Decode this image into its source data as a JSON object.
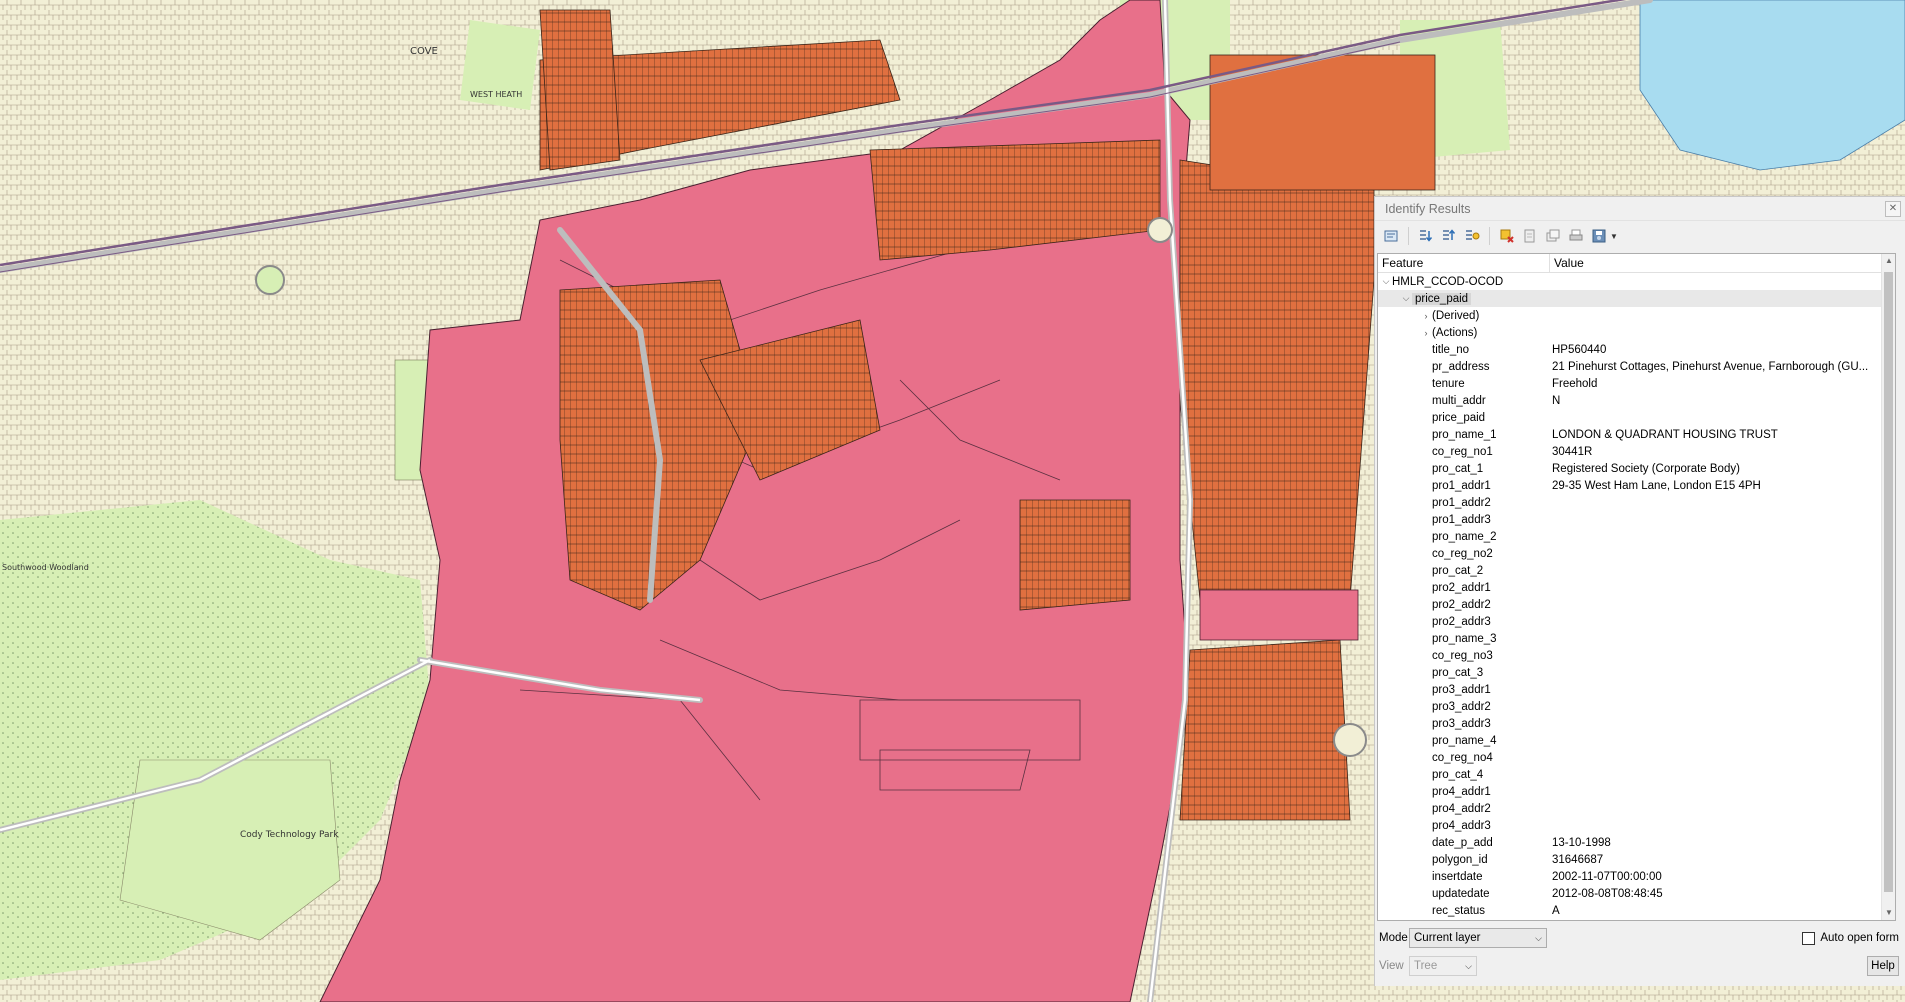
{
  "map": {
    "labels": {
      "cove": "COVE",
      "west_heath": "WEST HEATH",
      "southwood": "Southwood Woodland",
      "cody": "Cody Technology Park"
    },
    "colors": {
      "background": "#f2efd6",
      "green_space": "#d7efb5",
      "water": "#a8dcf0",
      "pink_parcel": "#e8708a",
      "orange_parcel": "#e07040",
      "road": "#bfbfbf",
      "railway": "#7a5a85"
    }
  },
  "identify": {
    "title": "Identify Results",
    "close_label": "✕",
    "toolbar_icons": [
      "expand-tree-icon",
      "expand-all-icon",
      "collapse-all-icon",
      "expand-new-icon",
      "clear-highlight-icon",
      "clear-results-icon",
      "copy-icon",
      "print-icon",
      "save-icon"
    ],
    "header": {
      "feature": "Feature",
      "value": "Value"
    },
    "layer": "HMLR_CCOD-OCOD",
    "feature_node": "price_paid",
    "sub_nodes": [
      "(Derived)",
      "(Actions)"
    ],
    "attributes": [
      {
        "name": "title_no",
        "value": "HP560440"
      },
      {
        "name": "pr_address",
        "value": "21 Pinehurst Cottages, Pinehurst Avenue, Farnborough (GU..."
      },
      {
        "name": "tenure",
        "value": "Freehold"
      },
      {
        "name": "multi_addr",
        "value": "N"
      },
      {
        "name": "price_paid",
        "value": ""
      },
      {
        "name": "pro_name_1",
        "value": "LONDON & QUADRANT HOUSING TRUST"
      },
      {
        "name": "co_reg_no1",
        "value": "30441R"
      },
      {
        "name": "pro_cat_1",
        "value": "Registered Society (Corporate Body)"
      },
      {
        "name": "pro1_addr1",
        "value": "29-35 West Ham Lane, London E15 4PH"
      },
      {
        "name": "pro1_addr2",
        "value": ""
      },
      {
        "name": "pro1_addr3",
        "value": ""
      },
      {
        "name": "pro_name_2",
        "value": ""
      },
      {
        "name": "co_reg_no2",
        "value": ""
      },
      {
        "name": "pro_cat_2",
        "value": ""
      },
      {
        "name": "pro2_addr1",
        "value": ""
      },
      {
        "name": "pro2_addr2",
        "value": ""
      },
      {
        "name": "pro2_addr3",
        "value": ""
      },
      {
        "name": "pro_name_3",
        "value": ""
      },
      {
        "name": "co_reg_no3",
        "value": ""
      },
      {
        "name": "pro_cat_3",
        "value": ""
      },
      {
        "name": "pro3_addr1",
        "value": ""
      },
      {
        "name": "pro3_addr2",
        "value": ""
      },
      {
        "name": "pro3_addr3",
        "value": ""
      },
      {
        "name": "pro_name_4",
        "value": ""
      },
      {
        "name": "co_reg_no4",
        "value": ""
      },
      {
        "name": "pro_cat_4",
        "value": ""
      },
      {
        "name": "pro4_addr1",
        "value": ""
      },
      {
        "name": "pro4_addr2",
        "value": ""
      },
      {
        "name": "pro4_addr3",
        "value": ""
      },
      {
        "name": "date_p_add",
        "value": "13-10-1998"
      },
      {
        "name": "polygon_id",
        "value": "31646687"
      },
      {
        "name": "insertdate",
        "value": "2002-11-07T00:00:00"
      },
      {
        "name": "updatedate",
        "value": "2012-08-08T08:48:45"
      },
      {
        "name": "rec_status",
        "value": "A"
      }
    ],
    "mode_label": "Mode",
    "mode_value": "Current layer",
    "auto_open_label": "Auto open form",
    "auto_open_checked": false,
    "view_label": "View",
    "view_value": "Tree",
    "help_label": "Help"
  }
}
